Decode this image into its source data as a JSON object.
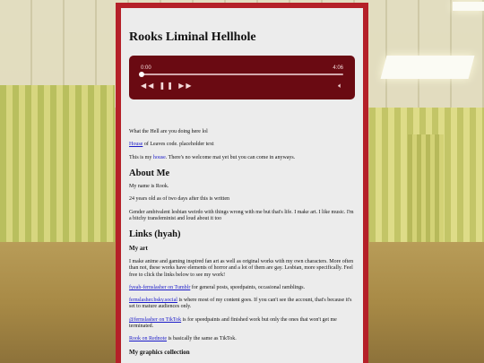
{
  "site": {
    "title": "Rooks Liminal Hellhole"
  },
  "player": {
    "current_time": "0:00",
    "duration": "4:06",
    "progress": 0.0,
    "rewind_icon": "rewind-icon",
    "pause_icon": "pause-icon",
    "forward_icon": "fast-forward-icon",
    "volume_icon": "volume-icon",
    "accent": "#6a0a12"
  },
  "intro": {
    "line1": "What the Hell are you doing here lol",
    "house_link": "House",
    "house_rest": " of Leaves code. placeholder text",
    "line3_pre": "This is my ",
    "line3_link": "house",
    "line3_post": ". There's no welcome mat yet but you can come in anyways."
  },
  "about": {
    "heading": "About Me",
    "name": "My name is Rook.",
    "age": "24 years old as of two days after this is written",
    "bio": "Gender ambivalent lesbian weirdo with things wrong with me but that's life. I make art. I like music. I'm a bitchy transfeminist and loud about it too"
  },
  "links": {
    "heading": "Links (hyah)",
    "art_heading": "My art",
    "art_desc": "I make anime and gaming inspired fan art as well as original works with my own characters. More often than not, these works have elements of horror and a lot of them are gay. Lesbian, more specifically. Feel free to click the links below to see my work!",
    "tumblr_link": "fyeah-fernslasher on Tumblr",
    "tumblr_rest": " for general posts, speedpaints, occasional ramblings.",
    "bsky_link": "fernslasher.bsky.social",
    "bsky_rest": " is where most of my content goes. If you can't see the account, that's because it's set to mature audiences only.",
    "tiktok_link": "@fernslasher on TikTok",
    "tiktok_rest": " is for speedpaints and finished work but only the ones that won't get me terminated.",
    "rednote_link": "Rook on Rednote",
    "rednote_rest": " is basically the same as TikTok.",
    "graphics_heading": "My graphics collection"
  },
  "colors": {
    "frame": "#b52028",
    "panel_bg": "#ececec",
    "link": "#1a1ac8"
  }
}
